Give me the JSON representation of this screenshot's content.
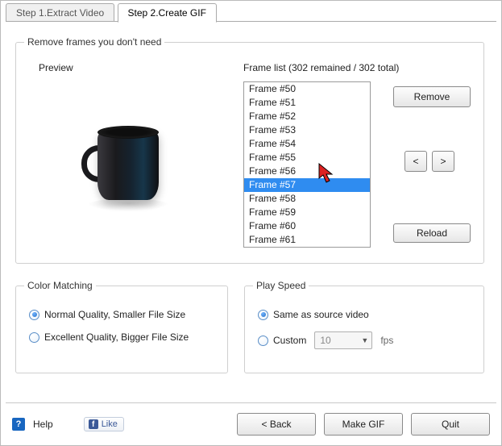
{
  "tabs": {
    "step1": "Step 1.Extract Video",
    "step2": "Step 2.Create GIF"
  },
  "frames_group": {
    "legend": "Remove frames you don't need",
    "preview_label": "Preview",
    "frame_list_label": "Frame list (302 remained / 302 total)",
    "remove_btn": "Remove",
    "reload_btn": "Reload",
    "prev_btn": "<",
    "next_btn": ">",
    "selected_index": 7,
    "items": [
      "Frame #50",
      "Frame #51",
      "Frame #52",
      "Frame #53",
      "Frame #54",
      "Frame #55",
      "Frame #56",
      "Frame #57",
      "Frame #58",
      "Frame #59",
      "Frame #60",
      "Frame #61"
    ]
  },
  "color_group": {
    "legend": "Color Matching",
    "opt_normal": "Normal Quality, Smaller File Size",
    "opt_excellent": "Excellent Quality, Bigger File Size",
    "selected": "normal"
  },
  "speed_group": {
    "legend": "Play Speed",
    "opt_same": "Same as source video",
    "opt_custom": "Custom",
    "fps_value": "10",
    "fps_label": "fps",
    "selected": "same"
  },
  "bottom": {
    "help": "Help",
    "like": "Like",
    "back": "< Back",
    "make": "Make GIF",
    "quit": "Quit"
  }
}
